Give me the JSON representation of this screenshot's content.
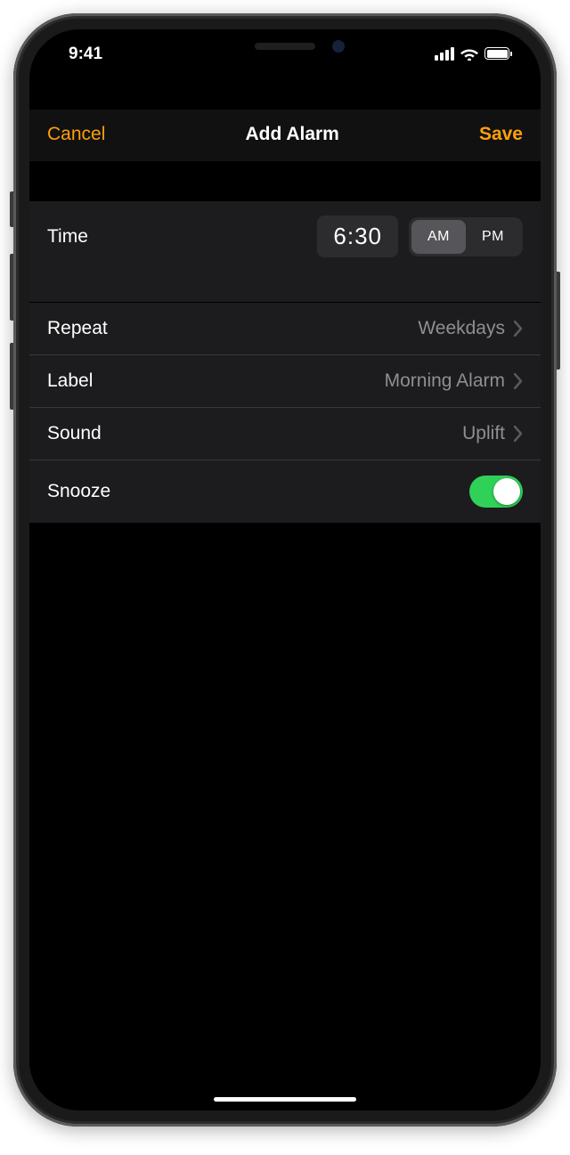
{
  "statusBar": {
    "time": "9:41"
  },
  "nav": {
    "cancel": "Cancel",
    "title": "Add Alarm",
    "save": "Save"
  },
  "time": {
    "label": "Time",
    "value": "6:30",
    "am": "AM",
    "pm": "PM",
    "selected": "AM"
  },
  "rows": {
    "repeat": {
      "label": "Repeat",
      "value": "Weekdays"
    },
    "label": {
      "label": "Label",
      "value": "Morning Alarm"
    },
    "sound": {
      "label": "Sound",
      "value": "Uplift"
    },
    "snooze": {
      "label": "Snooze",
      "on": true
    }
  },
  "colors": {
    "accent": "#ff9f0a",
    "toggleOn": "#30d158",
    "secondaryText": "#8e8e93"
  }
}
